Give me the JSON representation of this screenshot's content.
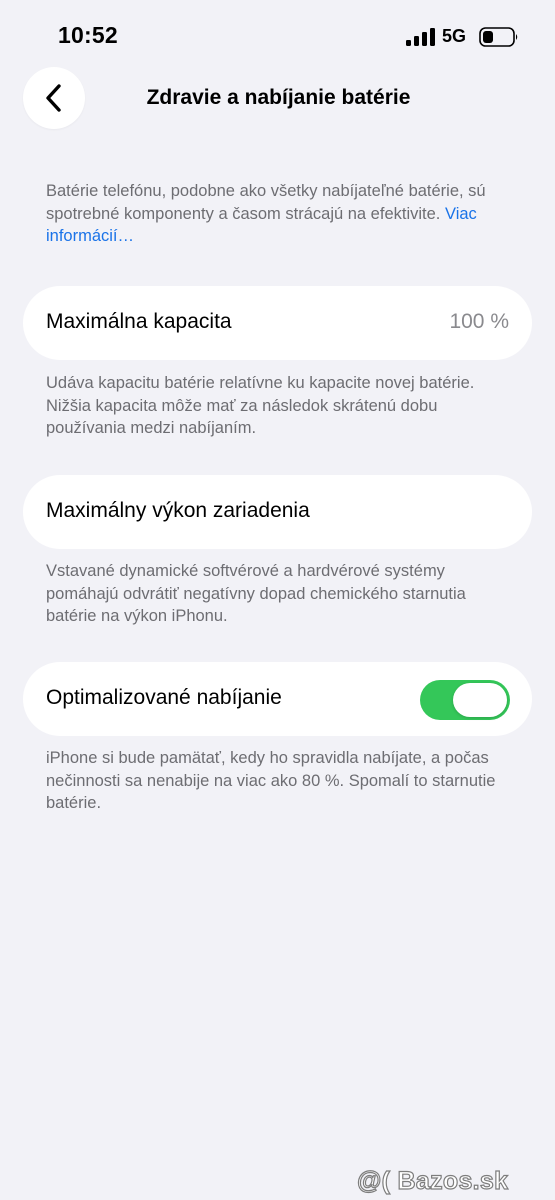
{
  "status_bar": {
    "time": "10:52",
    "network": "5G",
    "signal_icon": "cellular-signal-icon",
    "battery_icon": "battery-low-icon"
  },
  "nav": {
    "back_icon": "chevron-left-icon",
    "title": "Zdravie a nabíjanie batérie"
  },
  "intro": {
    "text": "Batérie telefónu, podobne ako všetky nabíjateľné batérie, sú spotrebné komponenty a časom strácajú na efektivite.",
    "link": "Viac informácií…"
  },
  "max_capacity": {
    "label": "Maximálna kapacita",
    "value": "100 %",
    "footnote": "Udáva kapacitu batérie relatívne ku kapacite novej batérie. Nižšia kapacita môže mať za následok skrátenú dobu používania medzi nabíjaním."
  },
  "peak_performance": {
    "label": "Maximálny výkon zariadenia",
    "footnote": "Vstavané dynamické softvérové a hardvérové systémy pomáhajú odvrátiť negatívny dopad chemického starnutia batérie na výkon iPhonu."
  },
  "optimized_charging": {
    "label": "Optimalizované nabíjanie",
    "enabled": true,
    "footnote": "iPhone si bude pamätať, kedy ho spravidla nabíjate, a počas nečinnosti sa nenabije na viac ako 80 %. Spomalí to starnutie batérie."
  },
  "colors": {
    "background": "#f2f2f7",
    "link": "#1a73e8",
    "toggle_on": "#34c759",
    "secondary_text": "#6d6d72"
  },
  "watermark": {
    "text": "@( Bazos.sk"
  }
}
